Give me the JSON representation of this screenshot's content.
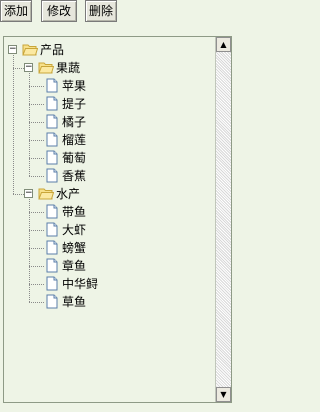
{
  "toolbar": {
    "add_label": "添加",
    "edit_label": "修改",
    "delete_label": "删除"
  },
  "tree": {
    "root": {
      "label": "产品",
      "children": [
        {
          "label": "果蔬",
          "children": [
            "苹果",
            "提子",
            "橘子",
            "榴莲",
            "葡萄",
            "香蕉"
          ]
        },
        {
          "label": "水产",
          "children": [
            "带鱼",
            "大虾",
            "螃蟹",
            "章鱼",
            "中华鲟",
            "草鱼"
          ]
        }
      ]
    }
  },
  "icons": {
    "expanded_toggle": "minus-box-icon",
    "folder": "open-folder-icon",
    "file": "document-icon",
    "scroll_up": "arrow-up-icon",
    "scroll_down": "arrow-down-icon"
  },
  "colors": {
    "background": "#eef4e6",
    "folder": "#f2d774",
    "file_border": "#5a7ea8"
  }
}
